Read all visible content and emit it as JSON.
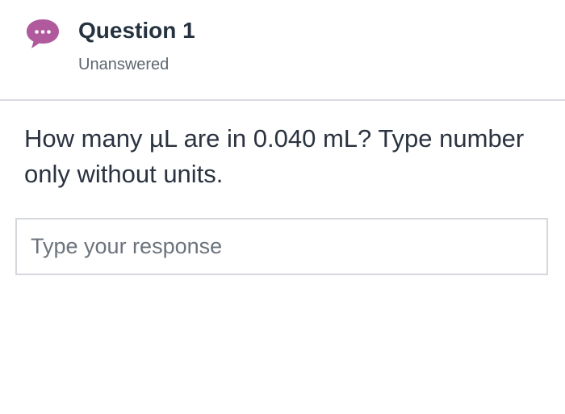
{
  "question": {
    "title": "Question 1",
    "status": "Unanswered",
    "status_icon": "speech-bubble-ellipsis-icon",
    "status_color": "#b05a9d",
    "prompt": "How many µL are in 0.040 mL?  Type number only without units."
  },
  "response": {
    "placeholder": "Type your response",
    "value": ""
  }
}
